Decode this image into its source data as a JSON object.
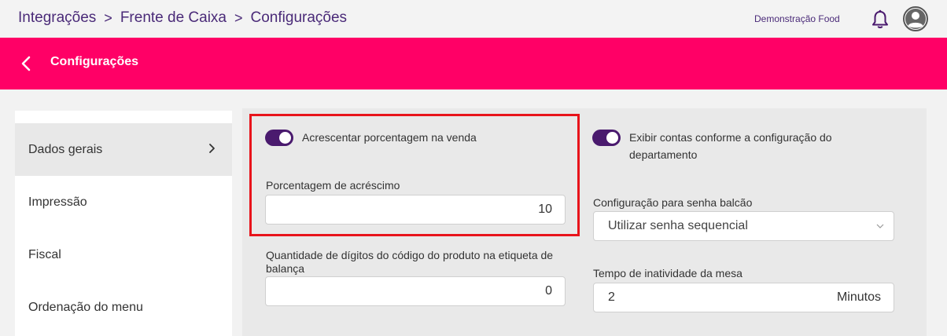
{
  "breadcrumb": {
    "items": [
      "Integrações",
      "Frente de Caixa",
      "Configurações"
    ],
    "separator": ">"
  },
  "header": {
    "company": "Demonstração Food"
  },
  "page": {
    "title": "Configurações"
  },
  "sidebar": {
    "items": [
      {
        "label": "Dados gerais",
        "active": true
      },
      {
        "label": "Impressão",
        "active": false
      },
      {
        "label": "Fiscal",
        "active": false
      },
      {
        "label": "Ordenação do menu",
        "active": false
      }
    ]
  },
  "settings": {
    "add_percentage": {
      "label": "Acrescentar porcentagem na venda",
      "enabled": true
    },
    "percentage_field": {
      "label": "Porcentagem de acréscimo",
      "value": "10"
    },
    "digits_field": {
      "label": "Quantidade de dígitos do código do produto na etiqueta de balança",
      "value": "0"
    },
    "show_accounts": {
      "label": "Exibir contas conforme a configuração do departamento",
      "enabled": true
    },
    "counter_password": {
      "label": "Configuração para senha balcão",
      "value": "Utilizar senha sequencial"
    },
    "table_inactivity": {
      "label": "Tempo de inatividade da mesa",
      "value": "2",
      "unit": "Minutos"
    }
  },
  "colors": {
    "brand_pink": "#ff0066",
    "toggle_on": "#4a1a6e",
    "highlight_border": "#e8141b",
    "breadcrumb_text": "#4a2a78"
  }
}
